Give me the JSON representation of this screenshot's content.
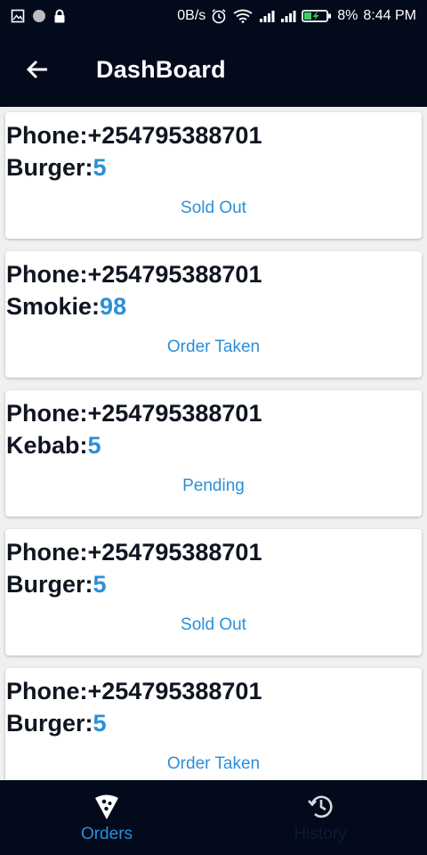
{
  "status_bar": {
    "speed": "0B/s",
    "battery": "8%",
    "time": "8:44 PM",
    "icons": [
      "image-icon",
      "dot-icon",
      "lock-icon",
      "alarm-icon",
      "wifi-icon",
      "signal-icon",
      "signal-icon",
      "battery-charging-icon"
    ]
  },
  "appbar": {
    "title": "DashBoard",
    "back_icon": "arrow-left-icon"
  },
  "orders": [
    {
      "phone_label": "Phone:",
      "phone": "+254795388701",
      "item": "Burger:",
      "qty": "5",
      "status": "Sold Out"
    },
    {
      "phone_label": "Phone:",
      "phone": "+254795388701",
      "item": "Smokie:",
      "qty": "98",
      "status": "Order Taken"
    },
    {
      "phone_label": "Phone:",
      "phone": "+254795388701",
      "item": "Kebab:",
      "qty": "5",
      "status": "Pending"
    },
    {
      "phone_label": "Phone:",
      "phone": "+254795388701",
      "item": "Burger:",
      "qty": "5",
      "status": "Sold Out"
    },
    {
      "phone_label": "Phone:",
      "phone": "+254795388701",
      "item": "Burger:",
      "qty": "5",
      "status": "Order Taken"
    }
  ],
  "bottom_nav": {
    "items": [
      {
        "label": "Orders",
        "icon": "pizza-icon",
        "active": true
      },
      {
        "label": "History",
        "icon": "history-icon",
        "active": false
      }
    ]
  },
  "colors": {
    "accent": "#2b8fd9",
    "bar": "#020a1c",
    "text": "#0f1520"
  }
}
